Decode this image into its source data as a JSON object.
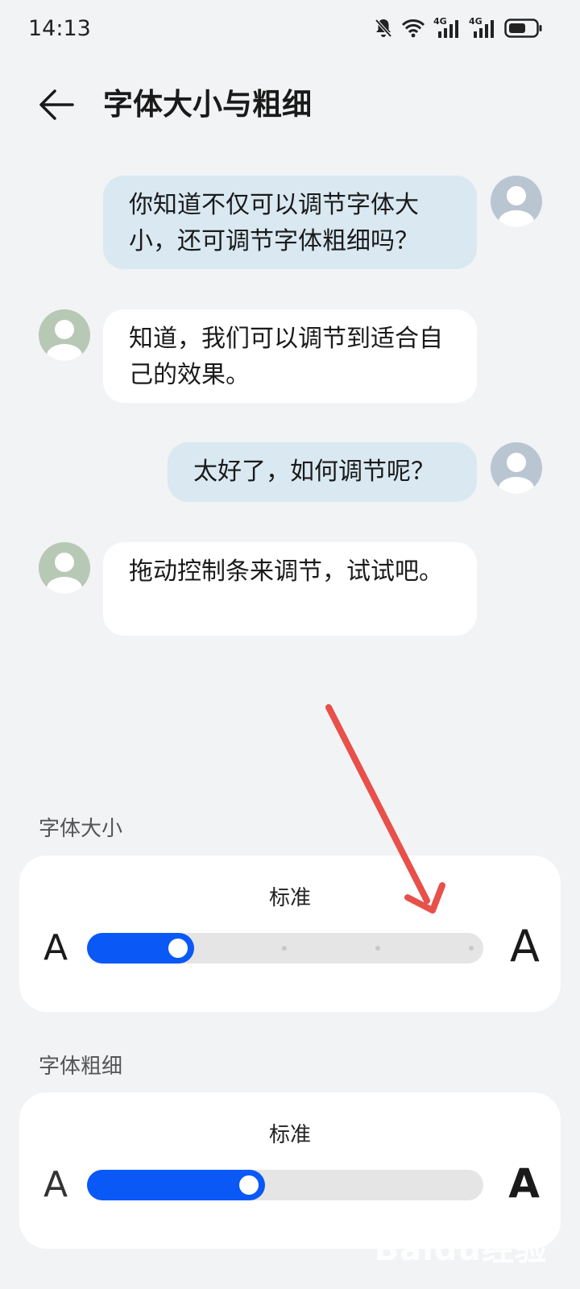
{
  "status_bar": {
    "time": "14:13",
    "icons": [
      "bell-off-icon",
      "wifi-icon",
      "signal-4g-icon",
      "signal-4g-icon",
      "battery-icon"
    ],
    "network_label_1": "4G",
    "network_label_2": "4G"
  },
  "header": {
    "title": "字体大小与粗细",
    "back_icon": "back-arrow-icon"
  },
  "chat": {
    "messages": [
      {
        "side": "right",
        "text": "你知道不仅可以调节字体大小，还可调节字体粗细吗？"
      },
      {
        "side": "left",
        "text": "知道，我们可以调节到适合自己的效果。"
      },
      {
        "side": "right",
        "text": "太好了，如何调节呢？"
      },
      {
        "side": "left",
        "text": "拖动控制条来调节，试试吧。"
      }
    ]
  },
  "font_size": {
    "section_label": "字体大小",
    "value_label": "标准",
    "small_glyph": "A",
    "large_glyph": "A",
    "level_fraction": 0.27
  },
  "font_weight": {
    "section_label": "字体粗细",
    "value_label": "标准",
    "small_glyph": "A",
    "large_glyph": "A",
    "level_fraction": 0.45
  },
  "colors": {
    "accent": "#0a59f7",
    "annotation_arrow": "#e8504a",
    "bubble_right": "#d9e8f1",
    "bubble_left": "#ffffff",
    "avatar_right": "#b9c6d2",
    "avatar_left": "#b7c8b5"
  },
  "watermark": "Baidu经验"
}
